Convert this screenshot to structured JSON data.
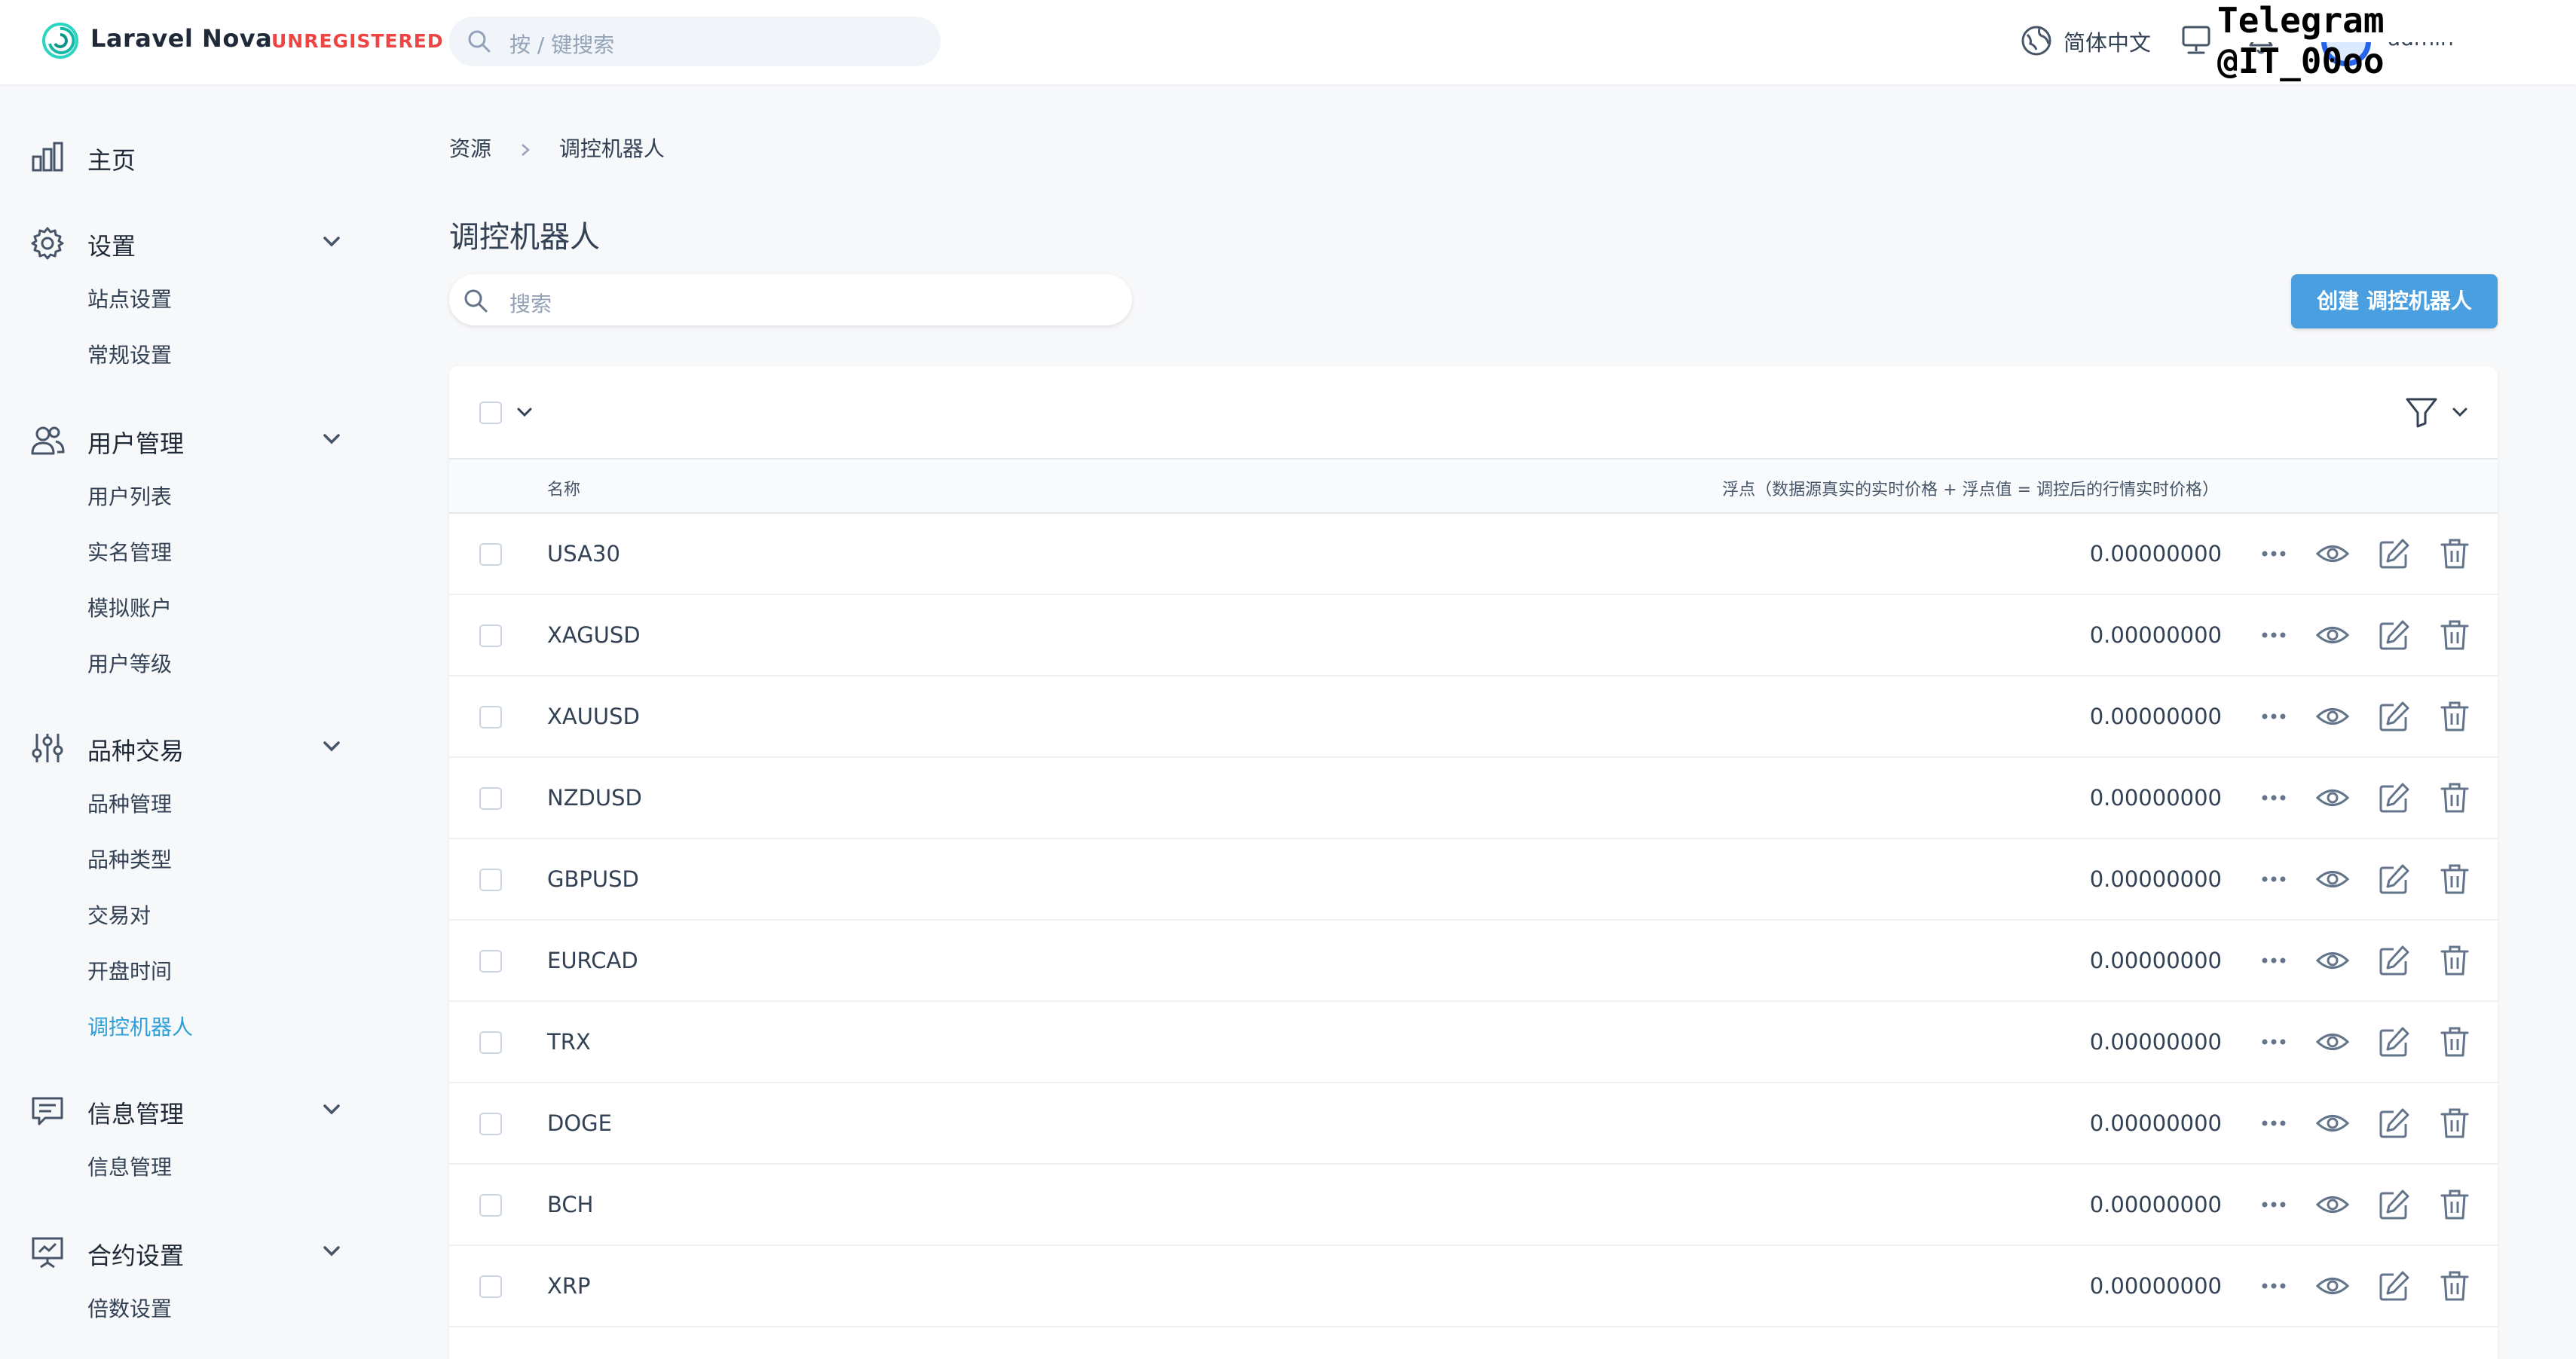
{
  "header": {
    "brand": "Laravel Nova",
    "unregistered": "UNREGISTERED",
    "search_placeholder": "按 / 键搜索",
    "language": "简体中文",
    "user_name": "admin",
    "watermark": "Telegram @IT_00oo"
  },
  "sidebar": {
    "sections": [
      {
        "label": "主页",
        "icon": "bar-chart-icon",
        "items": []
      },
      {
        "label": "设置",
        "icon": "gear-icon",
        "items": [
          "站点设置",
          "常规设置"
        ]
      },
      {
        "label": "用户管理",
        "icon": "users-icon",
        "items": [
          "用户列表",
          "实名管理",
          "模拟账户",
          "用户等级"
        ]
      },
      {
        "label": "品种交易",
        "icon": "sliders-icon",
        "items": [
          "品种管理",
          "品种类型",
          "交易对",
          "开盘时间",
          "调控机器人"
        ]
      },
      {
        "label": "信息管理",
        "icon": "chat-icon",
        "items": [
          "信息管理"
        ]
      },
      {
        "label": "合约设置",
        "icon": "presentation-icon",
        "items": [
          "倍数设置"
        ]
      }
    ],
    "active_item": "调控机器人"
  },
  "main": {
    "breadcrumb": [
      "资源",
      "调控机器人"
    ],
    "title": "调控机器人",
    "search_placeholder": "搜索",
    "create_button": "创建 调控机器人",
    "columns": {
      "name": "名称",
      "float": "浮点（数据源真实的实时价格 + 浮点值 = 调控后的行情实时价格）"
    },
    "rows": [
      {
        "name": "USA30",
        "float": "0.00000000"
      },
      {
        "name": "XAGUSD",
        "float": "0.00000000"
      },
      {
        "name": "XAUUSD",
        "float": "0.00000000"
      },
      {
        "name": "NZDUSD",
        "float": "0.00000000"
      },
      {
        "name": "GBPUSD",
        "float": "0.00000000"
      },
      {
        "name": "EURCAD",
        "float": "0.00000000"
      },
      {
        "name": "TRX",
        "float": "0.00000000"
      },
      {
        "name": "DOGE",
        "float": "0.00000000"
      },
      {
        "name": "BCH",
        "float": "0.00000000"
      },
      {
        "name": "XRP",
        "float": "0.00000000"
      }
    ]
  },
  "colors": {
    "accent": "#4a9fe0",
    "active_link": "#2e9fd9",
    "unregistered": "#ef4444",
    "icon_gray": "#64748b"
  }
}
